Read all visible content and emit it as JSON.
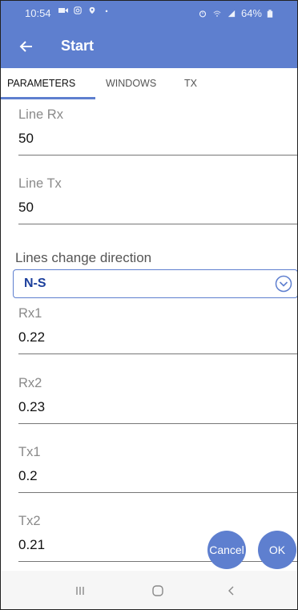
{
  "status_bar": {
    "time": "10:54",
    "left_icons": [
      "video-icon",
      "instagram-icon",
      "location-icon",
      "dot-icon"
    ],
    "right_icons": [
      "alarm-icon",
      "wifi-icon",
      "signal-icon"
    ],
    "battery": "64%"
  },
  "app_bar": {
    "title": "Start"
  },
  "tabs": [
    {
      "label": "PARAMETERS",
      "active": true
    },
    {
      "label": "WINDOWS",
      "active": false
    },
    {
      "label": "TX",
      "active": false
    }
  ],
  "fields": {
    "line_rx": {
      "label": "Line Rx",
      "value": "50"
    },
    "line_tx": {
      "label": "Line Tx",
      "value": "50"
    },
    "rx1": {
      "label": "Rx1",
      "value": "0.22"
    },
    "rx2": {
      "label": "Rx2",
      "value": "0.23"
    },
    "tx1": {
      "label": "Tx1",
      "value": "0.2"
    },
    "tx2": {
      "label": "Tx2",
      "value": "0.21"
    }
  },
  "direction": {
    "label": "Lines change direction",
    "value": "N-S"
  },
  "buttons": {
    "cancel": "Cancel",
    "ok": "OK"
  },
  "colors": {
    "primary": "#5e7fcf",
    "select_text": "#1c3f9c",
    "label": "#8a8a8a"
  }
}
